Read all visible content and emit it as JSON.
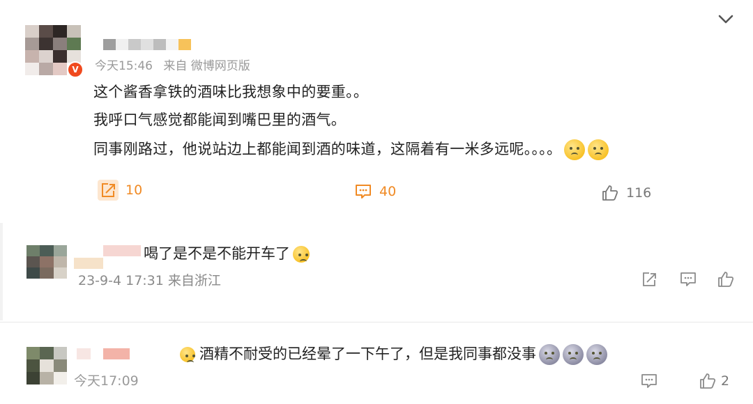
{
  "post": {
    "time": "今天15:46",
    "source": "来自 微博网页版",
    "lines": [
      "这个酱香拿铁的酒味比我想象中的要重。。",
      "我呼口气感觉都能闻到嘴巴里的酒气。",
      "同事刚路过，他说站边上都能闻到酒的味道，这隔着有一米多远呢。。。。"
    ],
    "reposts": "10",
    "comments": "40",
    "likes": "116",
    "badge": "V"
  },
  "comments": [
    {
      "text": "喝了是不是不能开车了",
      "meta": "23-9-4 17:31 来自浙江"
    },
    {
      "text": "酒精不耐受的已经晕了一下午了，但是我同事都没事",
      "meta": "今天17:09",
      "likes": "2"
    }
  ],
  "colors": {
    "accent": "#f08a24",
    "meta": "#999999",
    "icon_gray": "#8a8a8a",
    "emoji": "#f5b300"
  },
  "icons": [
    "chevron-down-icon",
    "repost-icon",
    "comment-icon",
    "like-icon",
    "emoji-sweat-icon",
    "emoji-laugh-cry-icon",
    "emoji-skull-icon"
  ]
}
